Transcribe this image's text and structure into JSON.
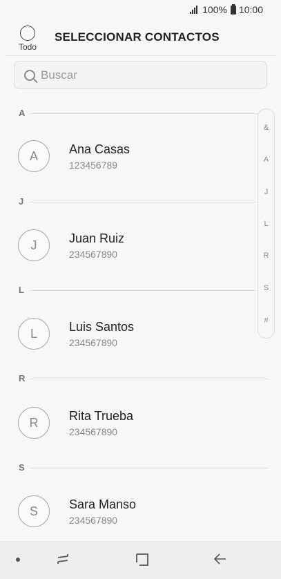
{
  "status_bar": {
    "battery": "100%",
    "time": "10:00"
  },
  "header": {
    "select_all_label": "Todo",
    "title": "SELECCIONAR CONTACTOS"
  },
  "search": {
    "placeholder": "Buscar"
  },
  "sections": [
    {
      "letter": "A",
      "contacts": [
        {
          "initial": "A",
          "name": "Ana Casas",
          "number": "123456789"
        }
      ]
    },
    {
      "letter": "J",
      "contacts": [
        {
          "initial": "J",
          "name": "Juan Ruiz",
          "number": "234567890"
        }
      ]
    },
    {
      "letter": "L",
      "contacts": [
        {
          "initial": "L",
          "name": "Luis Santos",
          "number": "234567890"
        }
      ]
    },
    {
      "letter": "R",
      "contacts": [
        {
          "initial": "R",
          "name": "Rita Trueba",
          "number": "234567890"
        }
      ]
    },
    {
      "letter": "S",
      "contacts": [
        {
          "initial": "S",
          "name": "Sara Manso",
          "number": "234567890"
        }
      ]
    }
  ],
  "index": [
    "&",
    "A",
    "J",
    "L",
    "R",
    "S",
    "#"
  ],
  "nav": {
    "icons": [
      "dot-icon",
      "recent-apps-icon",
      "home-icon",
      "back-icon"
    ]
  }
}
